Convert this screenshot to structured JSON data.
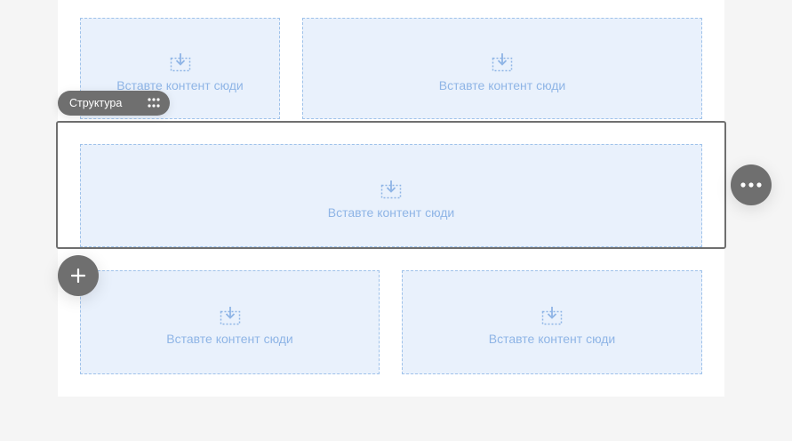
{
  "canvas": {
    "structure_badge": "Структура",
    "row1": [
      {
        "label": "Вставте контент сюди",
        "icon": "insert-content-icon"
      },
      {
        "label": "Вставте контент сюди",
        "icon": "insert-content-icon"
      }
    ],
    "selected_row": [
      {
        "label": "Вставте контент сюди",
        "icon": "insert-content-icon"
      }
    ],
    "row3": [
      {
        "label": "Вставте контент сюди",
        "icon": "insert-content-icon"
      },
      {
        "label": "Вставте контент сюди",
        "icon": "insert-content-icon"
      }
    ]
  },
  "controls": {
    "more_icon": "more-horizontal-icon",
    "add_icon": "plus-icon",
    "grip_icon": "drag-grip-icon"
  },
  "colors": {
    "page_background": "#f5f5f5",
    "canvas_background": "#ffffff",
    "drop_zone_fill": "#e9f1fc",
    "drop_zone_border": "#9fc2ea",
    "drop_zone_text": "#8fb5e6",
    "control_gray": "#6f6f6f"
  }
}
